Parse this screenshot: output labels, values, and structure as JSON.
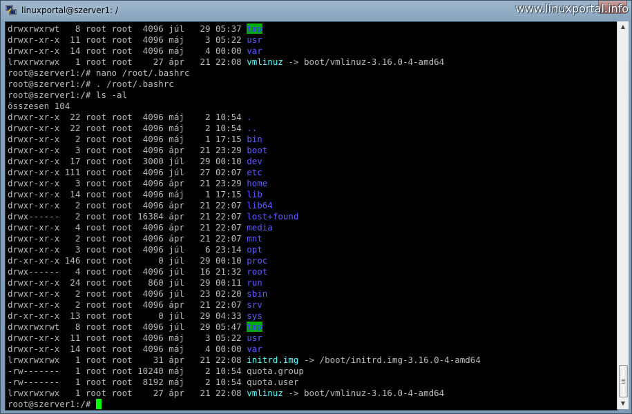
{
  "window": {
    "title": "linuxportal@szerver1: /",
    "watermark": "www.linuxportal.info"
  },
  "terminal": {
    "lines": [
      {
        "prefix": "drwxrwxrwt   8 root root  4096 júl   29 05:37 ",
        "name": "tmp",
        "kind": "hl",
        "suffix": ""
      },
      {
        "prefix": "drwxr-xr-x  11 root root  4096 máj    3 05:22 ",
        "name": "usr",
        "kind": "d",
        "suffix": ""
      },
      {
        "prefix": "drwxr-xr-x  14 root root  4096 máj    4 00:00 ",
        "name": "var",
        "kind": "d",
        "suffix": ""
      },
      {
        "prefix": "lrwxrwxrwx   1 root root    27 ápr   21 22:08 ",
        "name": "vmlinuz",
        "kind": "l",
        "suffix": " -> boot/vmlinuz-3.16.0-4-amd64"
      },
      {
        "prefix": "root@szerver1:/# nano /root/.bashrc",
        "name": "",
        "kind": "",
        "suffix": ""
      },
      {
        "prefix": "root@szerver1:/# . /root/.bashrc",
        "name": "",
        "kind": "",
        "suffix": ""
      },
      {
        "prefix": "root@szerver1:/# ls -al",
        "name": "",
        "kind": "",
        "suffix": ""
      },
      {
        "prefix": "összesen 104",
        "name": "",
        "kind": "",
        "suffix": ""
      },
      {
        "prefix": "drwxr-xr-x  22 root root  4096 máj    2 10:54 ",
        "name": ".",
        "kind": "d",
        "suffix": ""
      },
      {
        "prefix": "drwxr-xr-x  22 root root  4096 máj    2 10:54 ",
        "name": "..",
        "kind": "d",
        "suffix": ""
      },
      {
        "prefix": "drwxr-xr-x   2 root root  4096 máj    1 17:15 ",
        "name": "bin",
        "kind": "d",
        "suffix": ""
      },
      {
        "prefix": "drwxr-xr-x   3 root root  4096 ápr   21 23:29 ",
        "name": "boot",
        "kind": "d",
        "suffix": ""
      },
      {
        "prefix": "drwxr-xr-x  17 root root  3000 júl   29 00:10 ",
        "name": "dev",
        "kind": "d",
        "suffix": ""
      },
      {
        "prefix": "drwxr-xr-x 111 root root  4096 júl   27 02:07 ",
        "name": "etc",
        "kind": "d",
        "suffix": ""
      },
      {
        "prefix": "drwxr-xr-x   3 root root  4096 ápr   21 23:29 ",
        "name": "home",
        "kind": "d",
        "suffix": ""
      },
      {
        "prefix": "drwxr-xr-x  14 root root  4096 máj    1 17:15 ",
        "name": "lib",
        "kind": "d",
        "suffix": ""
      },
      {
        "prefix": "drwxr-xr-x   2 root root  4096 ápr   21 22:07 ",
        "name": "lib64",
        "kind": "d",
        "suffix": ""
      },
      {
        "prefix": "drwx------   2 root root 16384 ápr   21 22:07 ",
        "name": "lost+found",
        "kind": "d",
        "suffix": ""
      },
      {
        "prefix": "drwxr-xr-x   4 root root  4096 ápr   21 22:07 ",
        "name": "media",
        "kind": "d",
        "suffix": ""
      },
      {
        "prefix": "drwxr-xr-x   2 root root  4096 ápr   21 22:07 ",
        "name": "mnt",
        "kind": "d",
        "suffix": ""
      },
      {
        "prefix": "drwxr-xr-x   3 root root  4096 júl    6 23:14 ",
        "name": "opt",
        "kind": "d",
        "suffix": ""
      },
      {
        "prefix": "dr-xr-xr-x 146 root root     0 júl   29 00:10 ",
        "name": "proc",
        "kind": "d",
        "suffix": ""
      },
      {
        "prefix": "drwx------   4 root root  4096 júl   16 21:32 ",
        "name": "root",
        "kind": "d",
        "suffix": ""
      },
      {
        "prefix": "drwxr-xr-x  24 root root   860 júl   29 00:11 ",
        "name": "run",
        "kind": "d",
        "suffix": ""
      },
      {
        "prefix": "drwxr-xr-x   2 root root  4096 júl   23 02:20 ",
        "name": "sbin",
        "kind": "d",
        "suffix": ""
      },
      {
        "prefix": "drwxr-xr-x   2 root root  4096 ápr   21 22:07 ",
        "name": "srv",
        "kind": "d",
        "suffix": ""
      },
      {
        "prefix": "dr-xr-xr-x  13 root root     0 júl   29 04:33 ",
        "name": "sys",
        "kind": "d",
        "suffix": ""
      },
      {
        "prefix": "drwxrwxrwt   8 root root  4096 júl   29 05:47 ",
        "name": "tmp",
        "kind": "hl",
        "suffix": ""
      },
      {
        "prefix": "drwxr-xr-x  11 root root  4096 máj    3 05:22 ",
        "name": "usr",
        "kind": "d",
        "suffix": ""
      },
      {
        "prefix": "drwxr-xr-x  14 root root  4096 máj    4 00:00 ",
        "name": "var",
        "kind": "d",
        "suffix": ""
      },
      {
        "prefix": "lrwxrwxrwx   1 root root    31 ápr   21 22:08 ",
        "name": "initrd.img",
        "kind": "l",
        "suffix": " -> /boot/initrd.img-3.16.0-4-amd64"
      },
      {
        "prefix": "-rw-------   1 root root 10240 máj    2 10:54 quota.group",
        "name": "",
        "kind": "",
        "suffix": ""
      },
      {
        "prefix": "-rw-------   1 root root  8192 máj    2 10:54 quota.user",
        "name": "",
        "kind": "",
        "suffix": ""
      },
      {
        "prefix": "lrwxrwxrwx   1 root root    27 ápr   21 22:08 ",
        "name": "vmlinuz",
        "kind": "l",
        "suffix": " -> boot/vmlinuz-3.16.0-4-amd64"
      }
    ],
    "prompt": "root@szerver1:/# "
  },
  "colors": {
    "directory": "#5c5cff",
    "symlink": "#55ffff",
    "sticky_bg": "#00aa00",
    "cursor": "#00ff00",
    "text": "#bbbbbb"
  },
  "icons": {
    "app": "putty-icon",
    "close": "close-icon"
  }
}
